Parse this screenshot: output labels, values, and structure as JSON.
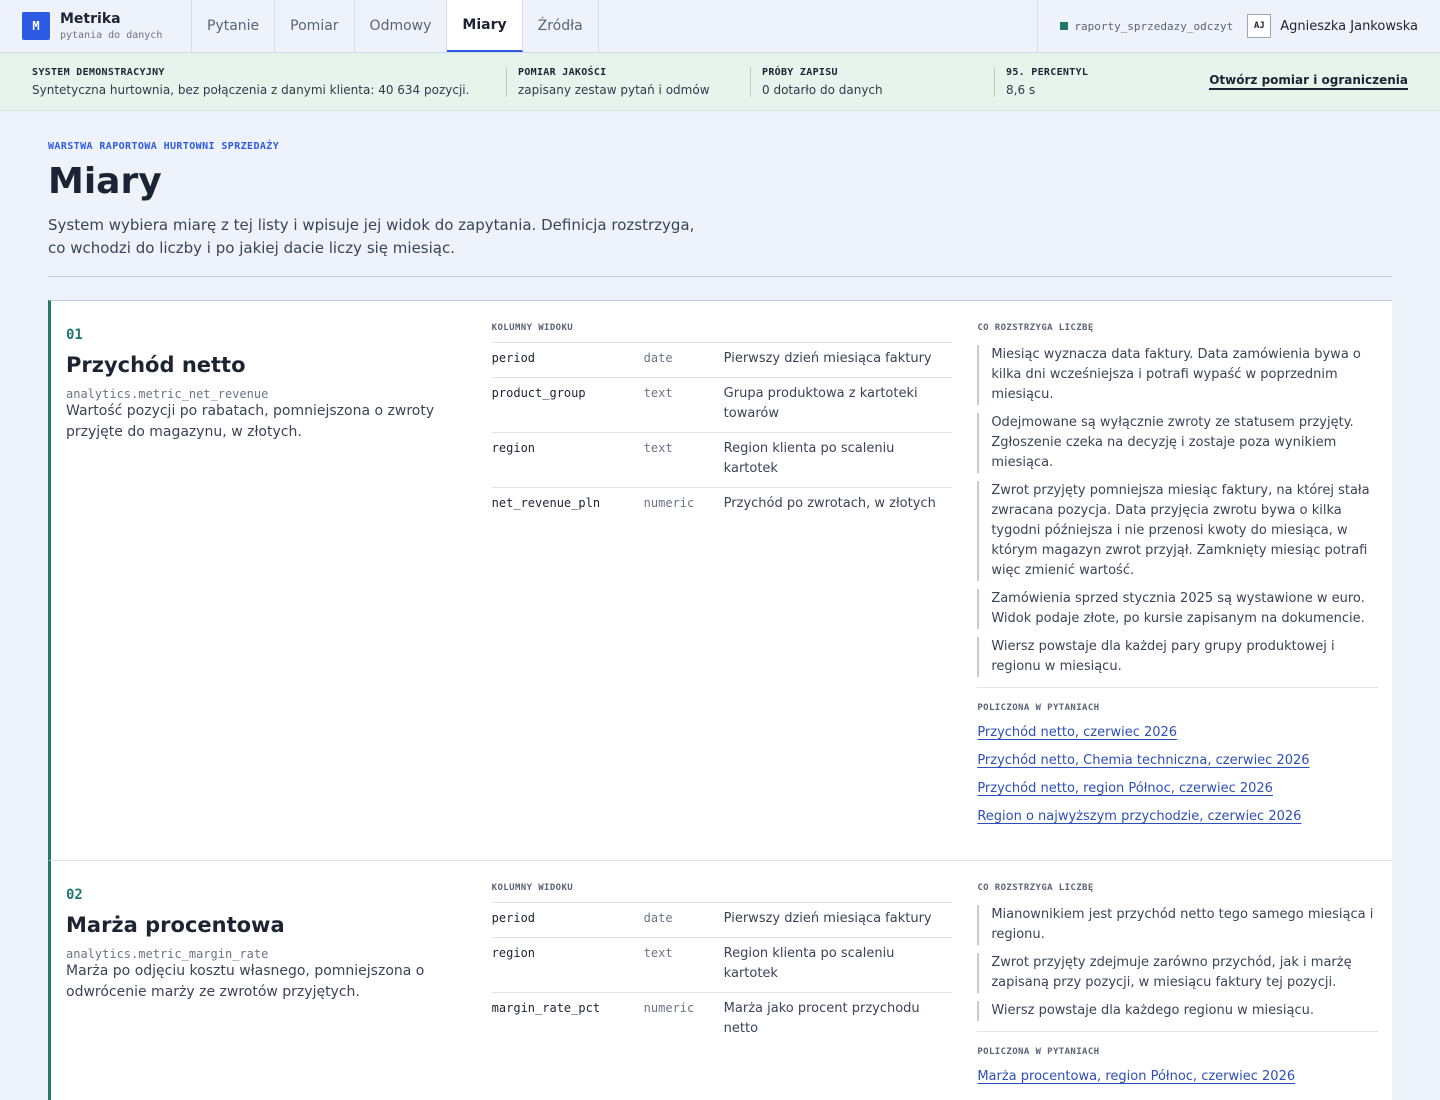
{
  "brand": {
    "logo_letter": "M",
    "name": "Metrika",
    "subtitle": "pytania do danych"
  },
  "nav": {
    "tabs": [
      {
        "label": "Pytanie"
      },
      {
        "label": "Pomiar"
      },
      {
        "label": "Odmowy"
      },
      {
        "label": "Miary",
        "active": true
      },
      {
        "label": "Źródła"
      }
    ]
  },
  "session": {
    "database": "raporty_sprzedazy_odczyt",
    "user_initials": "AJ",
    "user_name": "Agnieszka Jankowska"
  },
  "status_strip": {
    "items": [
      {
        "label": "SYSTEM DEMONSTRACYJNY",
        "value": "Syntetyczna hurtownia, bez połączenia z danymi klienta: 40 634 pozycji."
      },
      {
        "label": "POMIAR JAKOŚCI",
        "value": "zapisany zestaw pytań i odmów"
      },
      {
        "label": "PRÓBY ZAPISU",
        "value": "0 dotarło do danych"
      },
      {
        "label": "95. PERCENTYL",
        "value": "8,6 s"
      }
    ],
    "link": "Otwórz pomiar i ograniczenia"
  },
  "page": {
    "eyebrow": "WARSTWA RAPORTOWA HURTOWNI SPRZEDAŻY",
    "title": "Miary",
    "description": "System wybiera miarę z tej listy i wpisuje jej widok do zapytania. Definicja rozstrzyga, co wchodzi do liczby i po jakiej dacie liczy się miesiąc."
  },
  "labels": {
    "columns": "KOLUMNY WIDOKU",
    "rules": "CO ROZSTRZYGA LICZBĘ",
    "asked": "POLICZONA W PYTANIACH"
  },
  "metrics": [
    {
      "number": "01",
      "title": "Przychód netto",
      "schema": "analytics",
      "view": "metric_net_revenue",
      "description": "Wartość pozycji po rabatach, pomniejszona o zwroty przyjęte do magazynu, w złotych.",
      "columns": [
        {
          "name": "period",
          "type": "date",
          "desc": "Pierwszy dzień miesiąca faktury"
        },
        {
          "name": "product_group",
          "type": "text",
          "desc": "Grupa produktowa z kartoteki towarów"
        },
        {
          "name": "region",
          "type": "text",
          "desc": "Region klienta po scaleniu kartotek"
        },
        {
          "name": "net_revenue_pln",
          "type": "numeric",
          "desc": "Przychód po zwrotach, w złotych"
        }
      ],
      "rules": [
        "Miesiąc wyznacza data faktury. Data zamówienia bywa o kilka dni wcześniejsza i potrafi wypaść w poprzednim miesiącu.",
        "Odejmowane są wyłącznie zwroty ze statusem przyjęty. Zgłoszenie czeka na decyzję i zostaje poza wynikiem miesiąca.",
        "Zwrot przyjęty pomniejsza miesiąc faktury, na której stała zwracana pozycja. Data przyjęcia zwrotu bywa o kilka tygodni późniejsza i nie przenosi kwoty do miesiąca, w którym magazyn zwrot przyjął. Zamknięty miesiąc potrafi więc zmienić wartość.",
        "Zamówienia sprzed stycznia 2025 są wystawione w euro. Widok podaje złote, po kursie zapisanym na dokumencie.",
        "Wiersz powstaje dla każdej pary grupy produktowej i regionu w miesiącu."
      ],
      "asked": [
        "Przychód netto, czerwiec 2026",
        "Przychód netto, Chemia techniczna, czerwiec 2026",
        "Przychód netto, region Północ, czerwiec 2026",
        "Region o najwyższym przychodzie, czerwiec 2026"
      ]
    },
    {
      "number": "02",
      "title": "Marża procentowa",
      "schema": "analytics",
      "view": "metric_margin_rate",
      "description": "Marża po odjęciu kosztu własnego, pomniejszona o odwrócenie marży ze zwrotów przyjętych.",
      "columns": [
        {
          "name": "period",
          "type": "date",
          "desc": "Pierwszy dzień miesiąca faktury"
        },
        {
          "name": "region",
          "type": "text",
          "desc": "Region klienta po scaleniu kartotek"
        },
        {
          "name": "margin_rate_pct",
          "type": "numeric",
          "desc": "Marża jako procent przychodu netto"
        }
      ],
      "rules": [
        "Mianownikiem jest przychód netto tego samego miesiąca i regionu.",
        "Zwrot przyjęty zdejmuje zarówno przychód, jak i marżę zapisaną przy pozycji, w miesiącu faktury tej pozycji.",
        "Wiersz powstaje dla każdego regionu w miesiącu."
      ],
      "asked": [
        "Marża procentowa, region Północ, czerwiec 2026"
      ]
    }
  ],
  "colors": {
    "accent": "#2d5be3",
    "teal": "#1f7a6c",
    "link": "#2d4fb8",
    "strip_bg": "#e6f4ec"
  }
}
